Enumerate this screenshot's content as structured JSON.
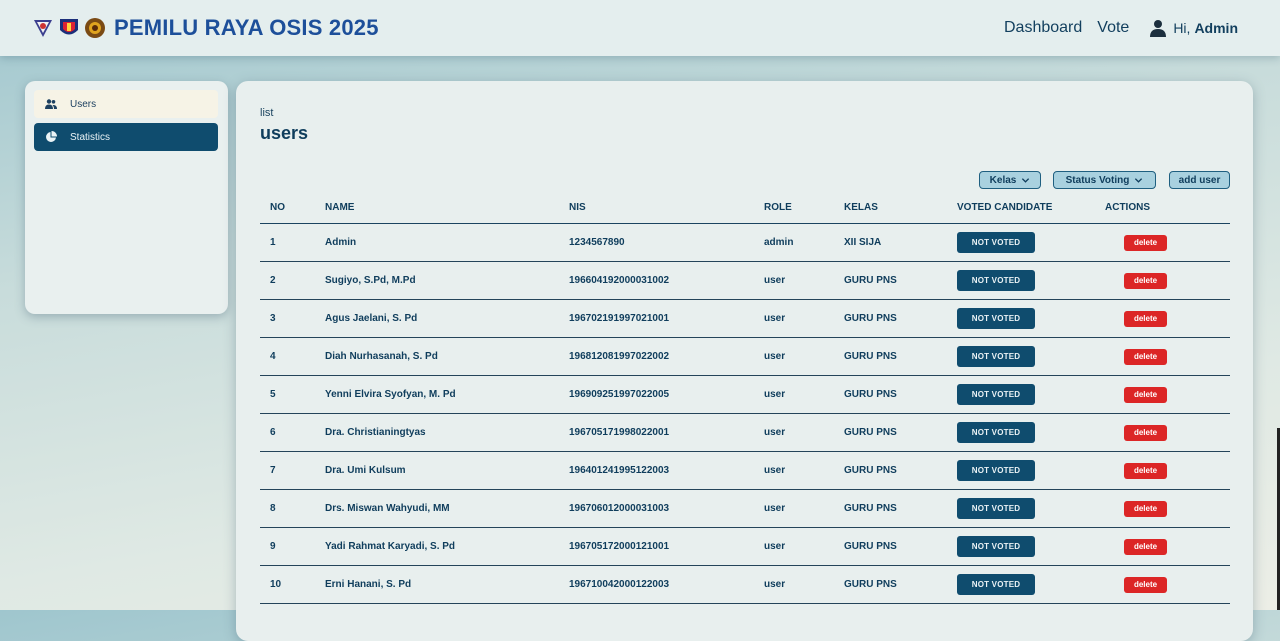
{
  "header": {
    "title": "PEMILU RAYA OSIS 2025",
    "logos": [
      "school-crest-logo",
      "osis-logo",
      "mpk-logo"
    ],
    "nav": {
      "dashboard": "Dashboard",
      "vote": "Vote"
    },
    "user": {
      "greeting": "Hi,",
      "name": "Admin"
    }
  },
  "sidebar": {
    "items": [
      {
        "label": "Users",
        "icon": "users-icon"
      },
      {
        "label": "Statistics",
        "icon": "pie-chart-icon"
      }
    ]
  },
  "main": {
    "breadcrumb": "list",
    "title": "users",
    "filters": {
      "kelas": "Kelas",
      "status": "Status Voting",
      "add_user": "add user"
    },
    "columns": {
      "no": "NO",
      "name": "NAME",
      "nis": "NIS",
      "role": "ROLE",
      "kelas": "KELAS",
      "voted": "VOTED CANDIDATE",
      "actions": "ACTIONS"
    },
    "rows": [
      {
        "no": "1",
        "name": "Admin",
        "nis": "1234567890",
        "role": "admin",
        "kelas": "XII SIJA",
        "voted": "NOT VOTED",
        "action": "delete"
      },
      {
        "no": "2",
        "name": "Sugiyo, S.Pd, M.Pd",
        "nis": "196604192000031002",
        "role": "user",
        "kelas": "GURU PNS",
        "voted": "NOT VOTED",
        "action": "delete"
      },
      {
        "no": "3",
        "name": "Agus Jaelani, S. Pd",
        "nis": "196702191997021001",
        "role": "user",
        "kelas": "GURU PNS",
        "voted": "NOT VOTED",
        "action": "delete"
      },
      {
        "no": "4",
        "name": "Diah Nurhasanah, S. Pd",
        "nis": "196812081997022002",
        "role": "user",
        "kelas": "GURU PNS",
        "voted": "NOT VOTED",
        "action": "delete"
      },
      {
        "no": "5",
        "name": "Yenni Elvira Syofyan, M. Pd",
        "nis": "196909251997022005",
        "role": "user",
        "kelas": "GURU PNS",
        "voted": "NOT VOTED",
        "action": "delete"
      },
      {
        "no": "6",
        "name": "Dra. Christianingtyas",
        "nis": "196705171998022001",
        "role": "user",
        "kelas": "GURU PNS",
        "voted": "NOT VOTED",
        "action": "delete"
      },
      {
        "no": "7",
        "name": "Dra. Umi Kulsum",
        "nis": "196401241995122003",
        "role": "user",
        "kelas": "GURU PNS",
        "voted": "NOT VOTED",
        "action": "delete"
      },
      {
        "no": "8",
        "name": "Drs. Miswan Wahyudi, MM",
        "nis": "196706012000031003",
        "role": "user",
        "kelas": "GURU PNS",
        "voted": "NOT VOTED",
        "action": "delete"
      },
      {
        "no": "9",
        "name": "Yadi Rahmat Karyadi, S. Pd",
        "nis": "196705172000121001",
        "role": "user",
        "kelas": "GURU PNS",
        "voted": "NOT VOTED",
        "action": "delete"
      },
      {
        "no": "10",
        "name": "Erni Hanani, S. Pd",
        "nis": "196710042000122003",
        "role": "user",
        "kelas": "GURU PNS",
        "voted": "NOT VOTED",
        "action": "delete"
      }
    ]
  },
  "colors": {
    "brand_title": "#1d4f9a",
    "primary": "#0f4c6e",
    "filter_bg": "#a9d1df",
    "danger": "#dc2626",
    "active_sidebar_bg": "#0f4c6e",
    "inactive_sidebar_bg": "#f6f3e6"
  }
}
